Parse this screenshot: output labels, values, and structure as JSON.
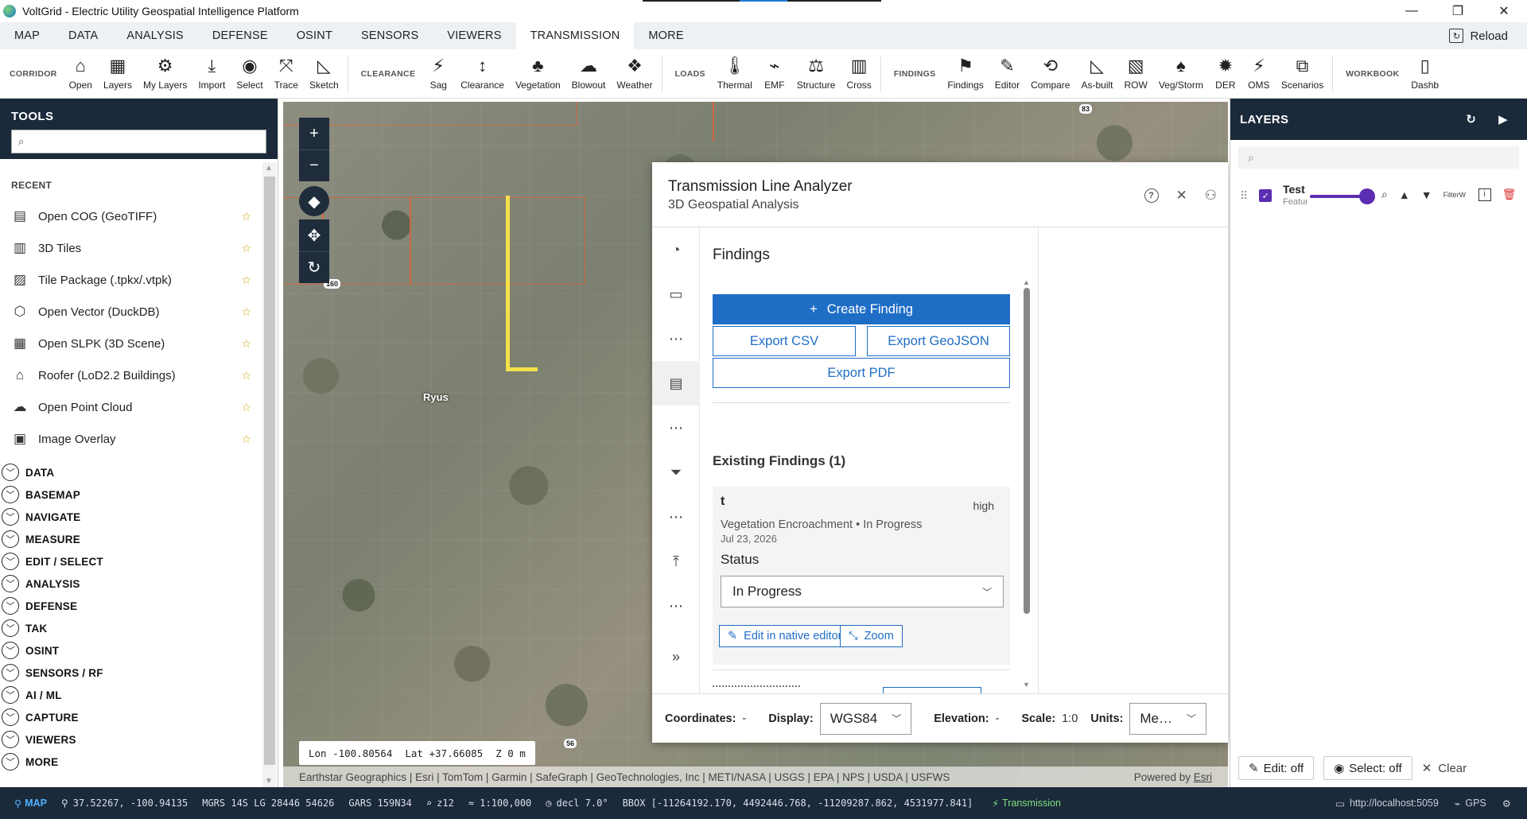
{
  "window": {
    "title": "VoltGrid - Electric Utility Geospatial Intelligence Platform",
    "minimize": "—",
    "maximize": "❐",
    "close": "✕"
  },
  "menu": {
    "tabs": [
      "MAP",
      "DATA",
      "ANALYSIS",
      "DEFENSE",
      "OSINT",
      "SENSORS",
      "VIEWERS",
      "TRANSMISSION",
      "MORE"
    ],
    "active": "TRANSMISSION",
    "reload_label": "Reload"
  },
  "ribbon": {
    "corridor_label": "CORRIDOR",
    "corridor": [
      {
        "label": "Open",
        "icon": "home-icon",
        "glyph": "⌂"
      },
      {
        "label": "Layers",
        "icon": "layers-map-icon",
        "glyph": "▦"
      },
      {
        "label": "My Layers",
        "icon": "gear-layers-icon",
        "glyph": "⚙"
      },
      {
        "label": "Import",
        "icon": "import-icon",
        "glyph": "⤓"
      },
      {
        "label": "Select",
        "icon": "select-icon",
        "glyph": "◉"
      },
      {
        "label": "Trace",
        "icon": "trace-icon",
        "glyph": "⤧"
      },
      {
        "label": "Sketch",
        "icon": "sketch-icon",
        "glyph": "◺"
      }
    ],
    "clearance_label": "CLEARANCE",
    "clearance": [
      {
        "label": "Sag",
        "icon": "sag-icon",
        "glyph": "⚡"
      },
      {
        "label": "Clearance",
        "icon": "clearance-icon",
        "glyph": "↕"
      },
      {
        "label": "Vegetation",
        "icon": "vegetation-icon",
        "glyph": "♣"
      },
      {
        "label": "Blowout",
        "icon": "blowout-icon",
        "glyph": "☁"
      },
      {
        "label": "Weather",
        "icon": "weather-icon",
        "glyph": "❖"
      }
    ],
    "loads_label": "LOADS",
    "loads": [
      {
        "label": "Thermal",
        "icon": "thermometer-icon",
        "glyph": "🌡"
      },
      {
        "label": "EMF",
        "icon": "emf-icon",
        "glyph": "⌁"
      },
      {
        "label": "Structure",
        "icon": "structure-icon",
        "glyph": "⚖"
      },
      {
        "label": "Cross",
        "icon": "cross-section-icon",
        "glyph": "▥"
      }
    ],
    "findings_label": "FINDINGS",
    "findings": [
      {
        "label": "Findings",
        "icon": "flag-icon",
        "glyph": "⚑"
      },
      {
        "label": "Editor",
        "icon": "editor-icon",
        "glyph": "✎"
      },
      {
        "label": "Compare",
        "icon": "compare-icon",
        "glyph": "⟲"
      },
      {
        "label": "As-built",
        "icon": "as-built-icon",
        "glyph": "◺"
      },
      {
        "label": "ROW",
        "icon": "row-icon",
        "glyph": "▧"
      },
      {
        "label": "Veg/Storm",
        "icon": "veg-storm-icon",
        "glyph": "♠"
      },
      {
        "label": "DER",
        "icon": "der-icon",
        "glyph": "✹"
      },
      {
        "label": "OMS",
        "icon": "oms-icon",
        "glyph": "⚡"
      },
      {
        "label": "Scenarios",
        "icon": "scenarios-icon",
        "glyph": "⧉"
      }
    ],
    "workbook_label": "WORKBOOK",
    "workbook": [
      {
        "label": "Dashb",
        "icon": "dashboard-icon",
        "glyph": "▯"
      }
    ]
  },
  "tools": {
    "title": "TOOLS",
    "search_placeholder": "",
    "recent_label": "RECENT",
    "recent": [
      {
        "label": "Open COG (GeoTIFF)",
        "icon": "cog-icon",
        "glyph": "▤"
      },
      {
        "label": "3D Tiles",
        "icon": "tiles-3d-icon",
        "glyph": "▥"
      },
      {
        "label": "Tile Package (.tpkx/.vtpk)",
        "icon": "tile-package-icon",
        "glyph": "▨"
      },
      {
        "label": "Open Vector (DuckDB)",
        "icon": "vector-icon",
        "glyph": "⬡"
      },
      {
        "label": "Open SLPK (3D Scene)",
        "icon": "slpk-icon",
        "glyph": "▦"
      },
      {
        "label": "Roofer (LoD2.2 Buildings)",
        "icon": "building-icon",
        "glyph": "⌂"
      },
      {
        "label": "Open Point Cloud",
        "icon": "cloud-icon",
        "glyph": "☁"
      },
      {
        "label": "Image Overlay",
        "icon": "image-overlay-icon",
        "glyph": "▣"
      }
    ],
    "star": "☆",
    "sections": [
      "DATA",
      "BASEMAP",
      "NAVIGATE",
      "MEASURE",
      "EDIT / SELECT",
      "ANALYSIS",
      "DEFENSE",
      "TAK",
      "OSINT",
      "SENSORS / RF",
      "AI / ML",
      "CAPTURE",
      "VIEWERS",
      "MORE"
    ]
  },
  "map": {
    "road_160": "160",
    "road_83": "83",
    "road_56": "56",
    "town": "Ryus",
    "coord_lon": "Lon -100.80564",
    "coord_lat": "Lat +37.66085",
    "coord_z": "Z 0 m",
    "attribution": "Earthstar Geographics | Esri | TomTom | Garmin | SafeGraph | GeoTechnologies, Inc | METI/NASA | USGS | EPA | NPS | USDA | USFWS",
    "powered_prefix": "Powered by ",
    "powered_link": "Esri"
  },
  "analyzer": {
    "title": "Transmission Line Analyzer",
    "subtitle": "3D Geospatial Analysis",
    "findings_heading": "Findings",
    "create_label": "Create Finding",
    "export_csv": "Export CSV",
    "export_geojson": "Export GeoJSON",
    "export_pdf": "Export PDF",
    "existing_heading": "Existing Findings (1)",
    "finding": {
      "title": "t",
      "severity": "high",
      "meta": "Vegetation Encroachment • In Progress",
      "date": "Jul 23, 2026",
      "status_label": "Status",
      "status_value": "In Progress",
      "edit_label": "Edit in native editor",
      "zoom_label": "Zoom"
    },
    "footer": {
      "coordinates_label": "Coordinates:",
      "coordinates_value": "-",
      "display_label": "Display:",
      "display_value": "WGS84",
      "elevation_label": "Elevation:",
      "elevation_value": "-",
      "scale_label": "Scale:",
      "scale_value": "1:0",
      "units_label": "Units:",
      "units_value": "Me…"
    }
  },
  "layers": {
    "title": "LAYERS",
    "search_placeholder": "",
    "item": {
      "name": "Test",
      "type": "Featur",
      "filter": "FilterW"
    },
    "edit_label": "Edit: off",
    "select_label": "Select: off",
    "clear_label": "Clear"
  },
  "status": {
    "mode": "MAP",
    "latlon": "37.52267, -100.94135",
    "mgrs": "MGRS 14S LG 28446 54626",
    "gars": "GARS 159N34",
    "zoom": "z12",
    "scale": "≈ 1:100,000",
    "decl": "decl 7.0°",
    "bbox": "BBOX [-11264192.170, 4492446.768, -11209287.862, 4531977.841]",
    "module": "Transmission",
    "server": "http://localhost:5059",
    "gps": "GPS"
  }
}
